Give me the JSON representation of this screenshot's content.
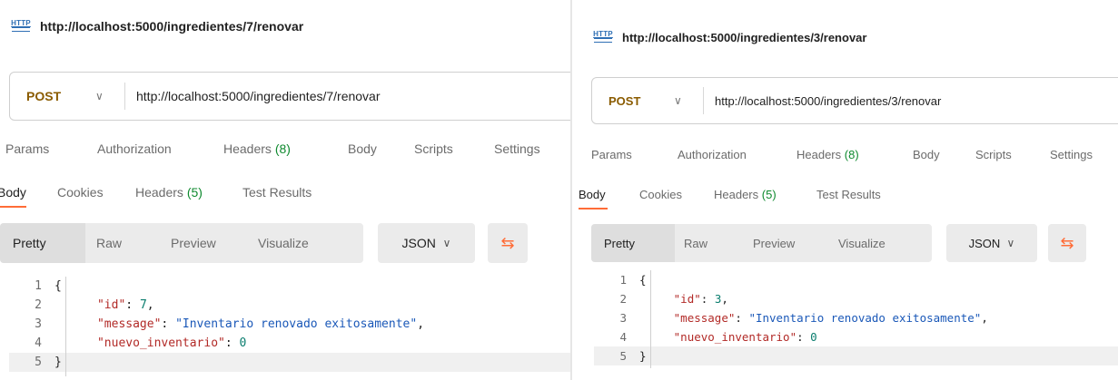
{
  "left": {
    "title_url": "http://localhost:5000/ingredientes/7/renovar",
    "method": "POST",
    "url": "http://localhost:5000/ingredientes/7/renovar",
    "id_value": "7"
  },
  "right": {
    "title_url": "http://localhost:5000/ingredientes/3/renovar",
    "method": "POST",
    "url": "http://localhost:5000/ingredientes/3/renovar",
    "id_value": "3"
  },
  "request_tabs": {
    "params": "Params",
    "authorization": "Authorization",
    "headers": "Headers",
    "headers_count": "(8)",
    "body": "Body",
    "scripts": "Scripts",
    "settings": "Settings"
  },
  "response_tabs": {
    "body": "Body",
    "cookies": "Cookies",
    "headers": "Headers",
    "headers_count": "(5)",
    "test_results": "Test Results"
  },
  "view_modes": {
    "pretty": "Pretty",
    "raw": "Raw",
    "preview": "Preview",
    "visualize": "Visualize"
  },
  "format": "JSON",
  "http_icon_text": "HTTP",
  "response_json": {
    "open_brace": "{",
    "close_brace": "}",
    "id_key": "\"id\"",
    "message_key": "\"message\"",
    "message_value": "\"Inventario renovado exitosamente\"",
    "nuevo_key": "\"nuevo_inventario\"",
    "nuevo_value": "0"
  },
  "line_numbers": [
    "1",
    "2",
    "3",
    "4",
    "5"
  ],
  "colors": {
    "method": "#8a5b00",
    "accent": "#ff6c37",
    "count_green": "#0f8a2f",
    "json_key": "#b22a27",
    "json_string": "#1a58b8",
    "json_number": "#0a7d6e"
  },
  "icons": [
    "http-icon",
    "chevron-down-icon",
    "wrap-lines-icon"
  ]
}
